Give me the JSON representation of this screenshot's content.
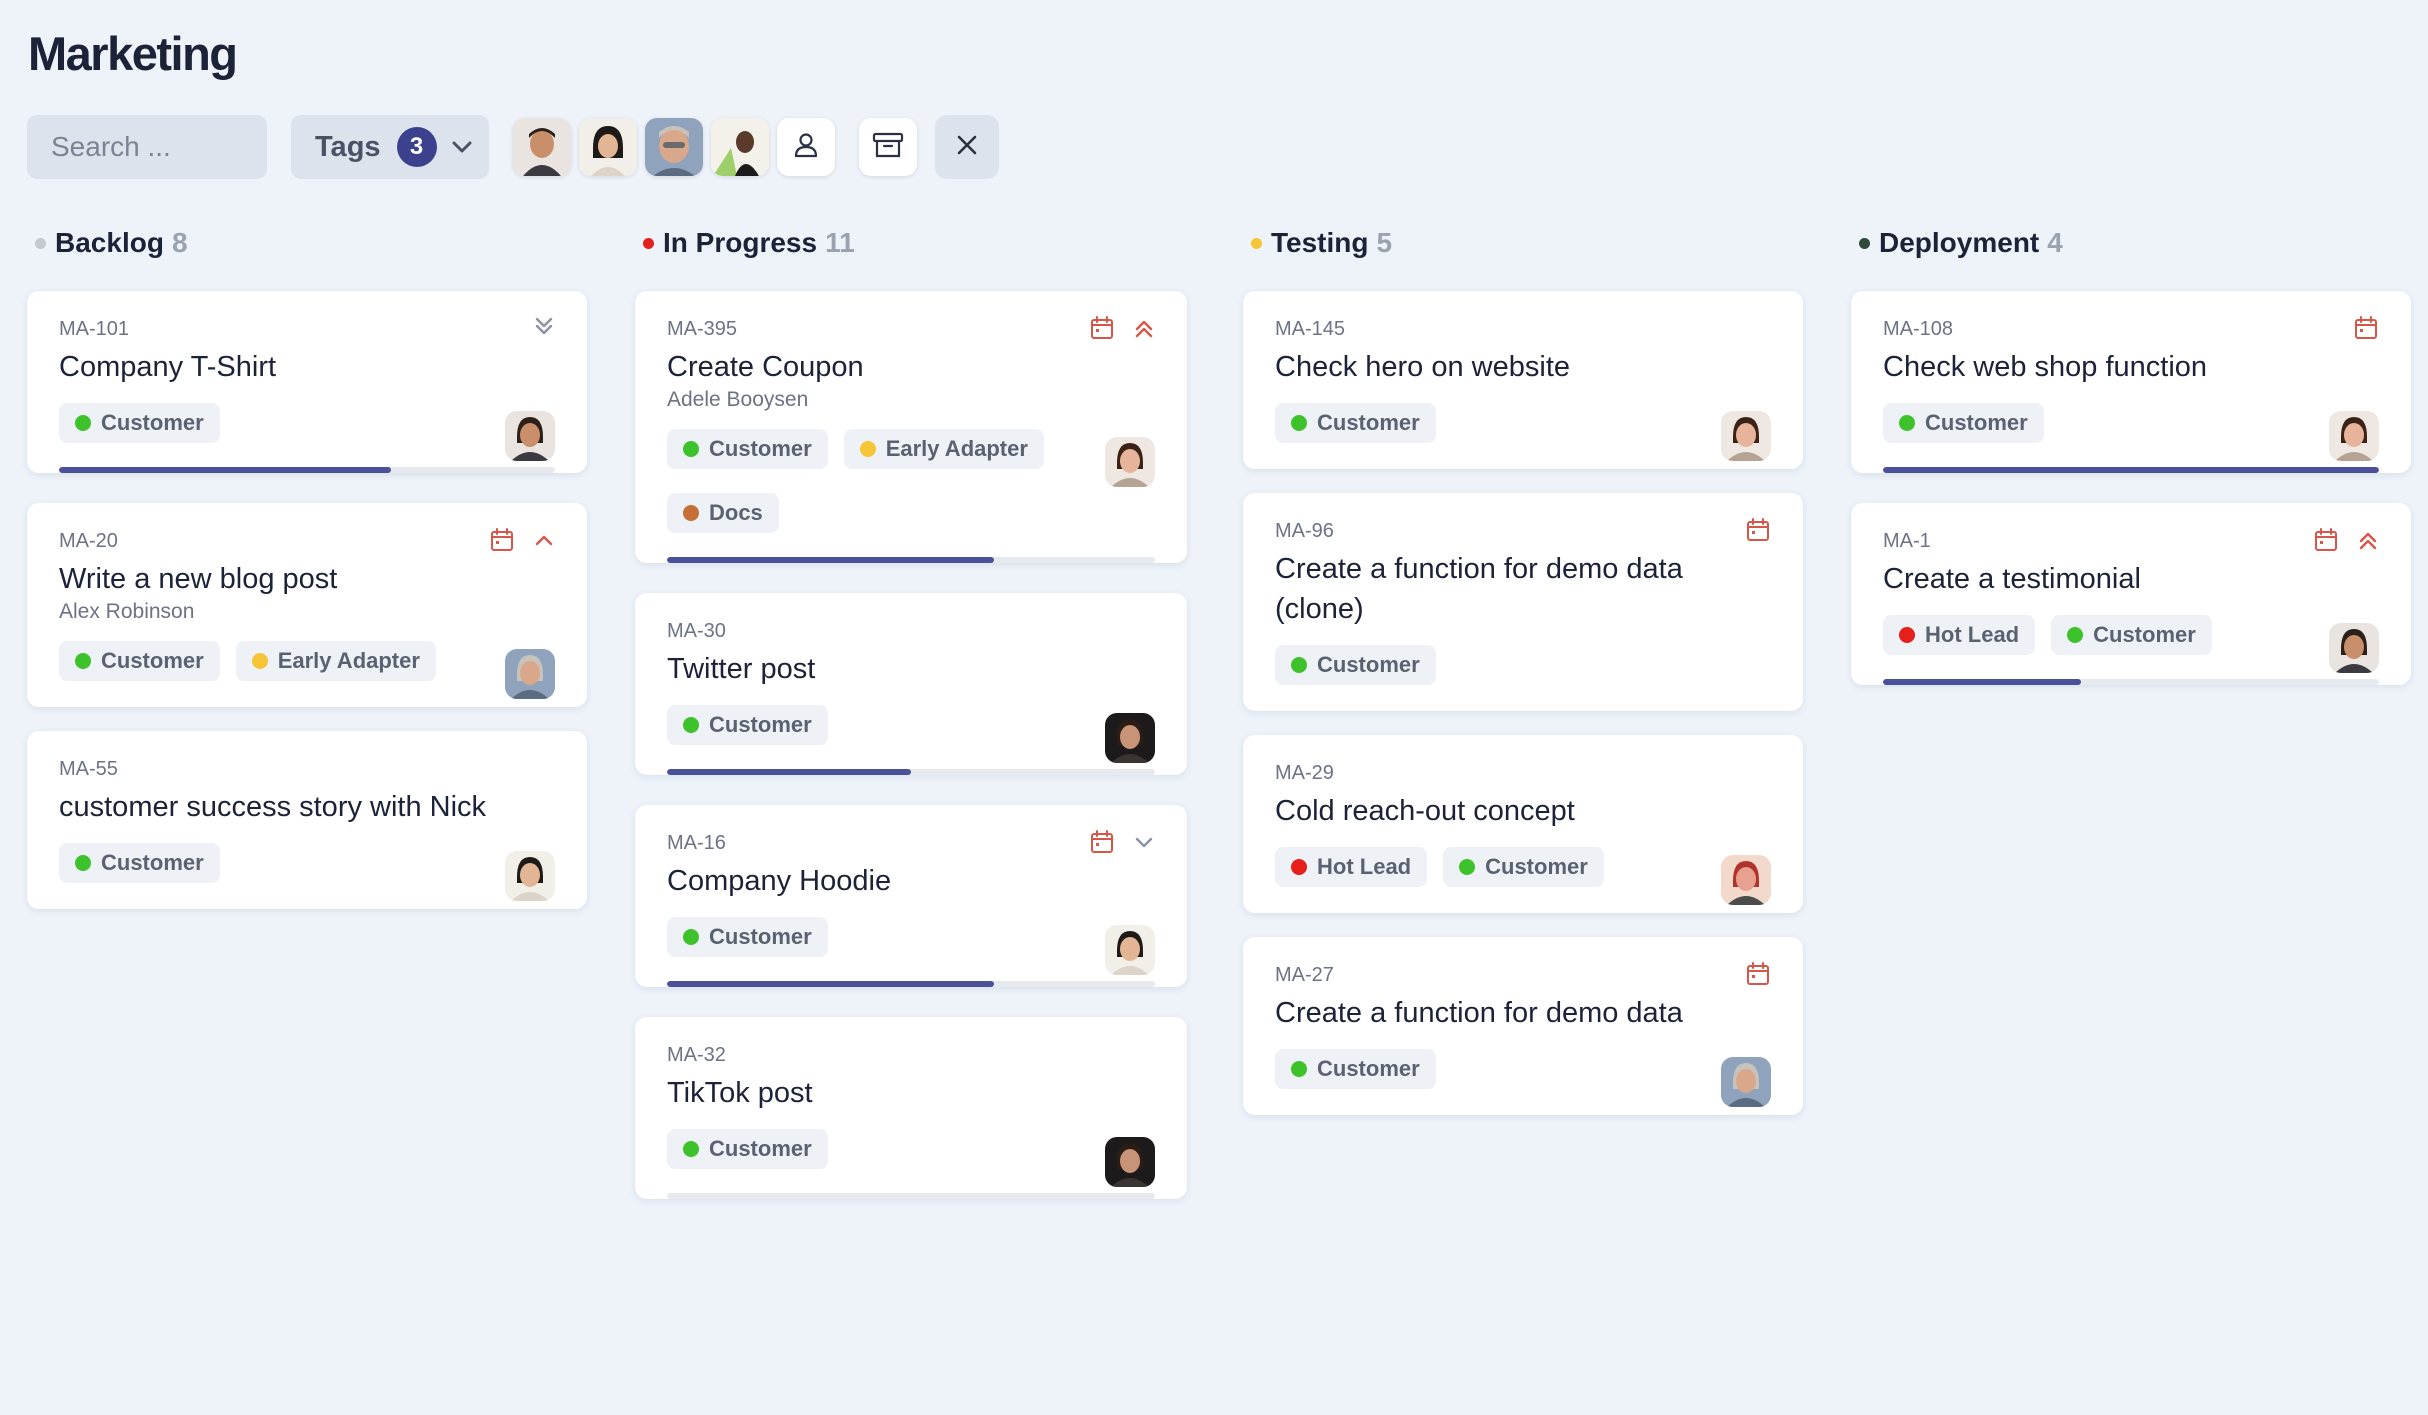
{
  "page": {
    "title": "Marketing"
  },
  "toolbar": {
    "search_placeholder": "Search ...",
    "tags_label": "Tags",
    "tags_count": "3"
  },
  "colors": {
    "customer": "#3ec22c",
    "early_adapter": "#f6c536",
    "docs": "#c56f36",
    "hot_lead": "#e5201a",
    "accent": "#3b418c",
    "icon_red": "#d6574a"
  },
  "columns": [
    {
      "title": "Backlog",
      "count": "8",
      "dot_color": "#c4c9d0",
      "cards": [
        {
          "id": "MA-101",
          "title": "Company T-Shirt",
          "tags": [
            "Customer"
          ],
          "progress": 0.67,
          "icons": [
            "double-chevron-down-icon"
          ]
        },
        {
          "id": "MA-20",
          "title": "Write a new blog post",
          "assignee": "Alex Robinson",
          "tags": [
            "Customer",
            "Early Adapter"
          ],
          "icons": [
            "calendar-icon",
            "chevron-up-icon"
          ]
        },
        {
          "id": "MA-55",
          "title": "customer success story with Nick",
          "tags": [
            "Customer"
          ]
        }
      ]
    },
    {
      "title": "In Progress",
      "count": "11",
      "dot_color": "#e5201a",
      "cards": [
        {
          "id": "MA-395",
          "title": "Create Coupon",
          "assignee": "Adele Booysen",
          "tags": [
            "Customer",
            "Early Adapter",
            "Docs"
          ],
          "progress": 0.67,
          "icons": [
            "calendar-icon",
            "double-chevron-up-icon"
          ]
        },
        {
          "id": "MA-30",
          "title": "Twitter post",
          "tags": [
            "Customer"
          ],
          "progress": 0.5
        },
        {
          "id": "MA-16",
          "title": "Company Hoodie",
          "tags": [
            "Customer"
          ],
          "progress": 0.67,
          "icons": [
            "calendar-icon",
            "chevron-down-icon"
          ]
        },
        {
          "id": "MA-32",
          "title": "TikTok post",
          "tags": [
            "Customer"
          ],
          "progress": 0
        }
      ]
    },
    {
      "title": "Testing",
      "count": "5",
      "dot_color": "#f6c536",
      "cards": [
        {
          "id": "MA-145",
          "title": "Check hero on website",
          "tags": [
            "Customer"
          ]
        },
        {
          "id": "MA-96",
          "title": "Create a function for demo data (clone)",
          "tags": [
            "Customer"
          ],
          "icons": [
            "calendar-icon"
          ]
        },
        {
          "id": "MA-29",
          "title": "Cold reach-out concept",
          "tags": [
            "Hot Lead",
            "Customer"
          ]
        },
        {
          "id": "MA-27",
          "title": "Create a function for demo data",
          "tags": [
            "Customer"
          ],
          "icons": [
            "calendar-icon"
          ]
        }
      ]
    },
    {
      "title": "Deployment",
      "count": "4",
      "dot_color": "#2f4a3a",
      "cards": [
        {
          "id": "MA-108",
          "title": "Check web shop function",
          "tags": [
            "Customer"
          ],
          "progress": 1.0,
          "icons": [
            "calendar-icon"
          ]
        },
        {
          "id": "MA-1",
          "title": "Create a testimonial",
          "tags": [
            "Hot Lead",
            "Customer"
          ],
          "progress": 0.4,
          "icons": [
            "calendar-icon",
            "double-chevron-up-icon"
          ]
        }
      ]
    }
  ]
}
